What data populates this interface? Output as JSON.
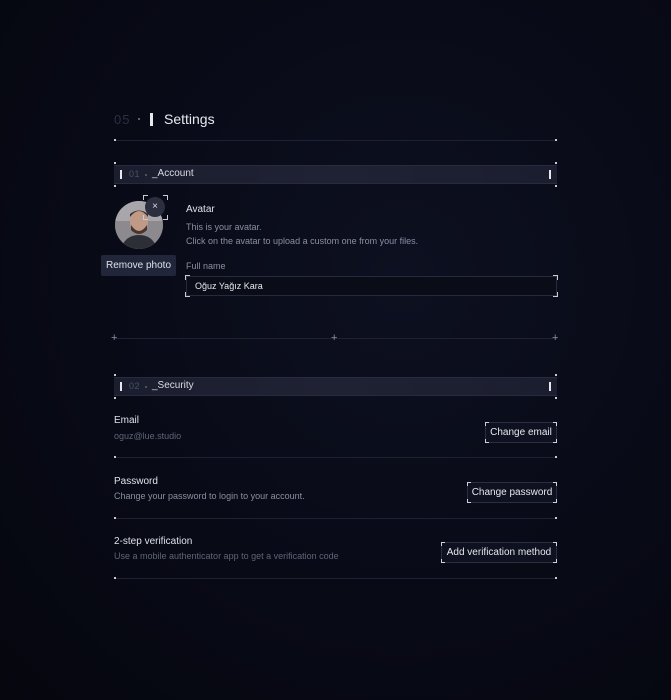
{
  "header": {
    "number": "05",
    "title": "Settings"
  },
  "account": {
    "number": "01",
    "title": "_Account",
    "avatar_label": "Avatar",
    "avatar_desc_1": "This is your avatar.",
    "avatar_desc_2": "Click on the avatar to upload a custom one from your files.",
    "remove_photo": "Remove photo",
    "remove_icon_glyph": "×",
    "full_name_label": "Full name",
    "full_name_value": "Oğuz Yağız Kara"
  },
  "security": {
    "number": "02",
    "title": "_Security",
    "email_label": "Email",
    "email_value": "oguz@lue.studio",
    "change_email": "Change email",
    "password_label": "Password",
    "password_desc": "Change your password to login to your account.",
    "change_password": "Change password",
    "twofa_label": "2-step verification",
    "twofa_desc": "Use a mobile authenticator app to get a verification code",
    "add_method": "Add verification method"
  },
  "icons": {
    "close": "close-icon",
    "plus": "plus-icon"
  },
  "colors": {
    "background": "#080a16",
    "accent": "#e6e8ee"
  }
}
